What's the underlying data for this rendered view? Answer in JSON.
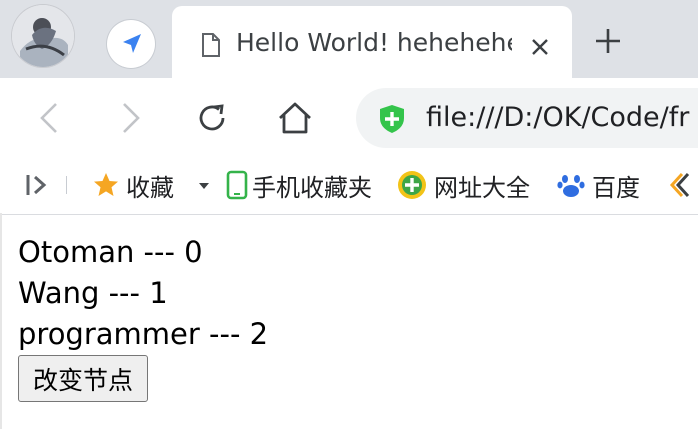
{
  "tab": {
    "title": "Hello World! hehehehehe"
  },
  "toolbar": {
    "url": "file:///D:/OK/Code/fr"
  },
  "bookmarks": {
    "items": [
      {
        "label": "收藏"
      },
      {
        "label": "手机收藏夹"
      },
      {
        "label": "网址大全"
      },
      {
        "label": "百度"
      }
    ]
  },
  "page": {
    "lines": [
      "Otoman --- 0",
      "Wang --- 1",
      "programmer --- 2"
    ],
    "button_label": "改变节点"
  },
  "colors": {
    "tabbar_bg": "#dee1e6",
    "secure_green": "#34c44b",
    "nav_blue": "#3b82f0"
  }
}
